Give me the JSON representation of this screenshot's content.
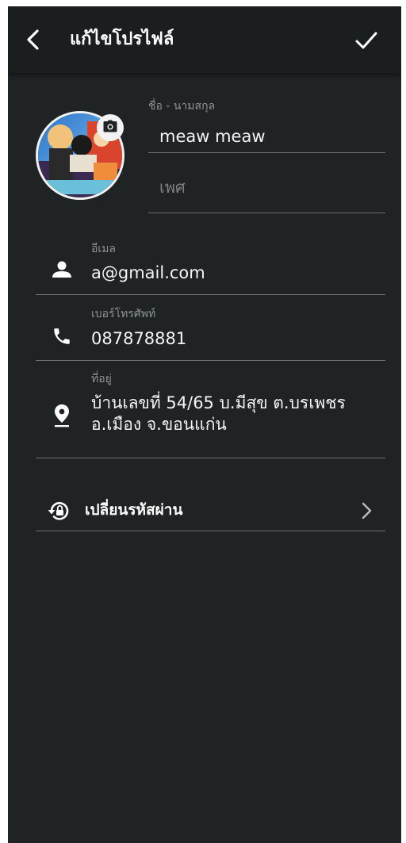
{
  "header": {
    "title": "แก้ไขโปรไฟล์",
    "back_icon": "chevron-left-icon",
    "save_icon": "check-icon"
  },
  "profile": {
    "avatar_icon": "avatar-photo",
    "camera_icon": "camera-icon",
    "name_label": "ชื่อ - นามสกุล",
    "name_value": "meaw meaw",
    "gender_placeholder": "เพศ"
  },
  "contact": {
    "email_label": "อีเมล",
    "email_value": "a@gmail.com",
    "phone_label": "เบอร์โทรศัพท์",
    "phone_value": "087878881",
    "address_label": "ที่อยู่",
    "address_value": "บ้านเลขที่ 54/65 บ.มีสุข ต.บรเพชร อ.เมือง จ.ขอนแก่น"
  },
  "security": {
    "change_password_label": "เปลี่ยนรหัสผ่าน",
    "icon": "lock-reset-icon"
  },
  "colors": {
    "background": "#1f2323",
    "appbar": "#1b1e1e",
    "text": "#f4f4f4",
    "label": "#8d9393",
    "divider": "#6c7272"
  }
}
